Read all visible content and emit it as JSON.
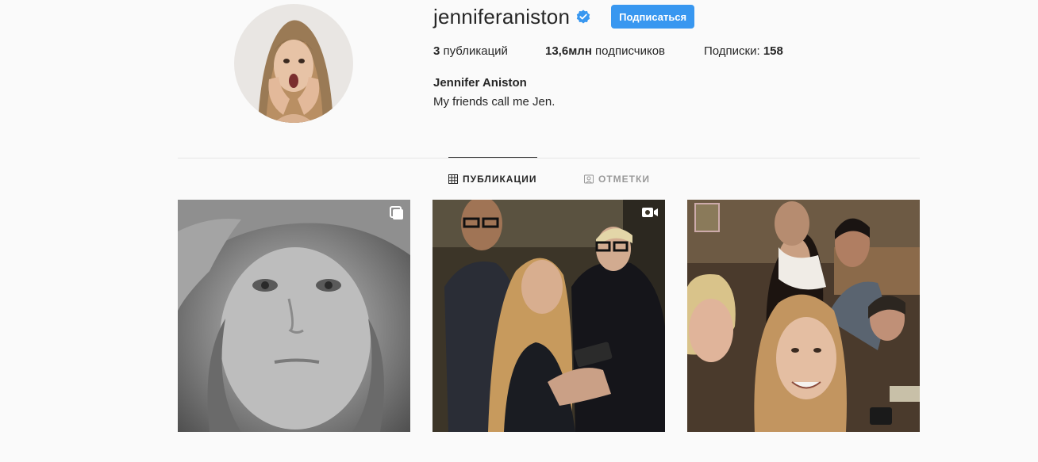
{
  "profile": {
    "username": "jenniferaniston",
    "verified": true,
    "follow_label": "Подписаться",
    "stats": {
      "posts_count": "3",
      "posts_label": " публикаций",
      "followers_count": "13,6млн",
      "followers_label": " подписчиков",
      "following_label": "Подписки: ",
      "following_count": "158"
    },
    "full_name": "Jennifer Aniston",
    "bio": "My friends call me Jen."
  },
  "tabs": [
    {
      "label": "ПУБЛИКАЦИИ",
      "icon": "grid-icon",
      "active": true
    },
    {
      "label": "ОТМЕТКИ",
      "icon": "tagged-icon",
      "active": false
    }
  ],
  "posts": [
    {
      "type": "photo",
      "badge": "multiple-photos-icon"
    },
    {
      "type": "video",
      "badge": "video-icon"
    },
    {
      "type": "photo",
      "badge": null
    }
  ],
  "colors": {
    "accent": "#3897f0",
    "background": "#fafafa",
    "text": "#262626",
    "muted": "#999999",
    "divider": "#e6e6e6"
  }
}
